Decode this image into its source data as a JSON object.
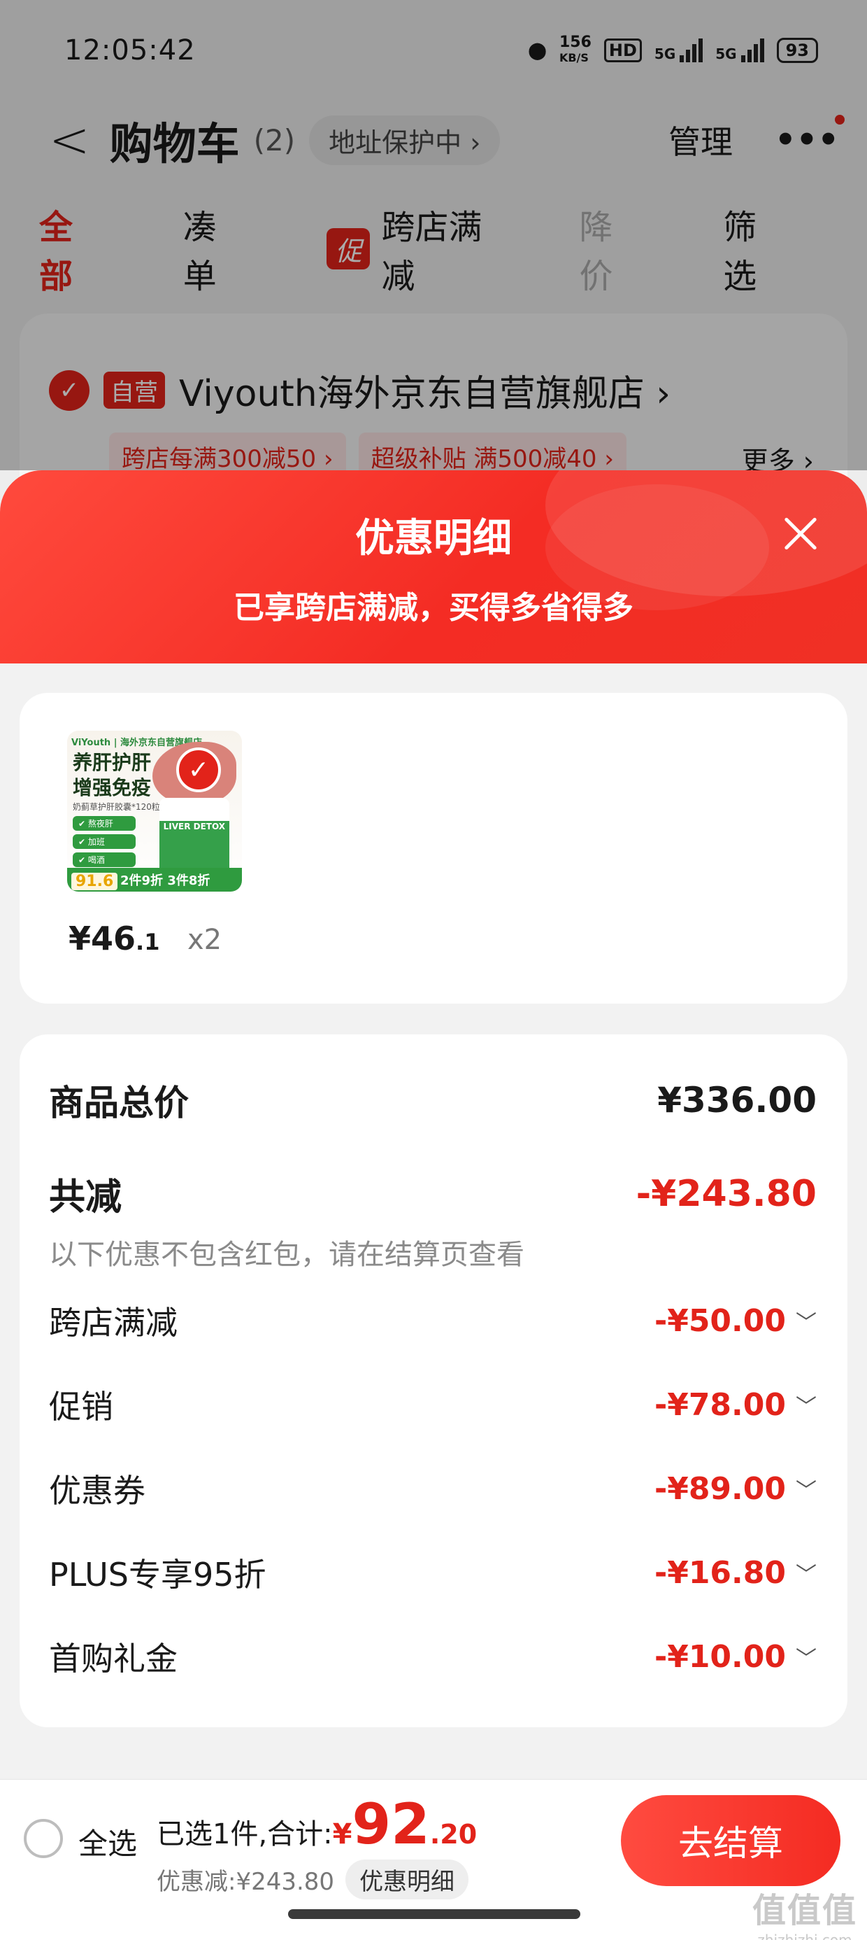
{
  "status_bar": {
    "time": "12:05:42",
    "net_speed": "156",
    "net_unit": "KB/S",
    "hd": "HD",
    "sig1": "5G",
    "sig2": "5G",
    "battery": "93"
  },
  "nav": {
    "back": "<",
    "title": "购物车",
    "count": "(2)",
    "address": "地址保护中 ›",
    "manage": "管理",
    "more": "•••"
  },
  "tabs": [
    {
      "label": "全部"
    },
    {
      "label": "凑单"
    },
    {
      "label": "跨店满减",
      "badge": "促"
    },
    {
      "label": "降价"
    },
    {
      "label": "筛选"
    }
  ],
  "shop": {
    "self_tag": "自营",
    "name": "Viyouth海外京东自营旗舰店 ›",
    "tags": [
      "跨店每满300减50 ›",
      "超级补贴  满500减40 ›"
    ],
    "more": "更多 ›"
  },
  "sheet": {
    "title": "优惠明细",
    "subtitle": "已享跨店满减，买得多省得多"
  },
  "product": {
    "image": {
      "brand": "ViYouth | 海外京东自营旗舰店",
      "headline1": "养肝护肝",
      "headline2": "增强免疫",
      "desc": "奶蓟草护肝胶囊*120粒",
      "pills": [
        "✔ 熬夜肝",
        "✔ 加班",
        "✔ 喝酒"
      ],
      "bottle": "LIVER DETOX",
      "price": "91.6",
      "deal": "2件9折 3件8折"
    },
    "price_main": "¥46",
    "price_dec": ".1",
    "qty": "x2"
  },
  "summary": {
    "total_label": "商品总价",
    "total_value": "¥336.00",
    "reduce_label": "共减",
    "reduce_value": "-¥243.80",
    "note": "以下优惠不包含红包，请在结算页查看",
    "items": [
      {
        "label": "跨店满减",
        "value": "-¥50.00"
      },
      {
        "label": "促销",
        "value": "-¥78.00"
      },
      {
        "label": "优惠券",
        "value": "-¥89.00"
      },
      {
        "label": "PLUS专享95折",
        "value": "-¥16.80"
      },
      {
        "label": "首购礼金",
        "value": "-¥10.00"
      }
    ]
  },
  "bottom": {
    "select_all": "全选",
    "selected_prefix": "已选1件,合计:",
    "currency": "¥",
    "amount_int": "92",
    "amount_dec": ".20",
    "discount": "优惠减:¥243.80",
    "detail": "优惠明细",
    "checkout": "去结算"
  },
  "watermark": {
    "logo": "值值值",
    "url": "zhizhizhi.com"
  },
  "colors": {
    "accent": "#e2231a",
    "sheet_gradient_start": "#ff4a3d",
    "sheet_gradient_end": "#f03025"
  }
}
